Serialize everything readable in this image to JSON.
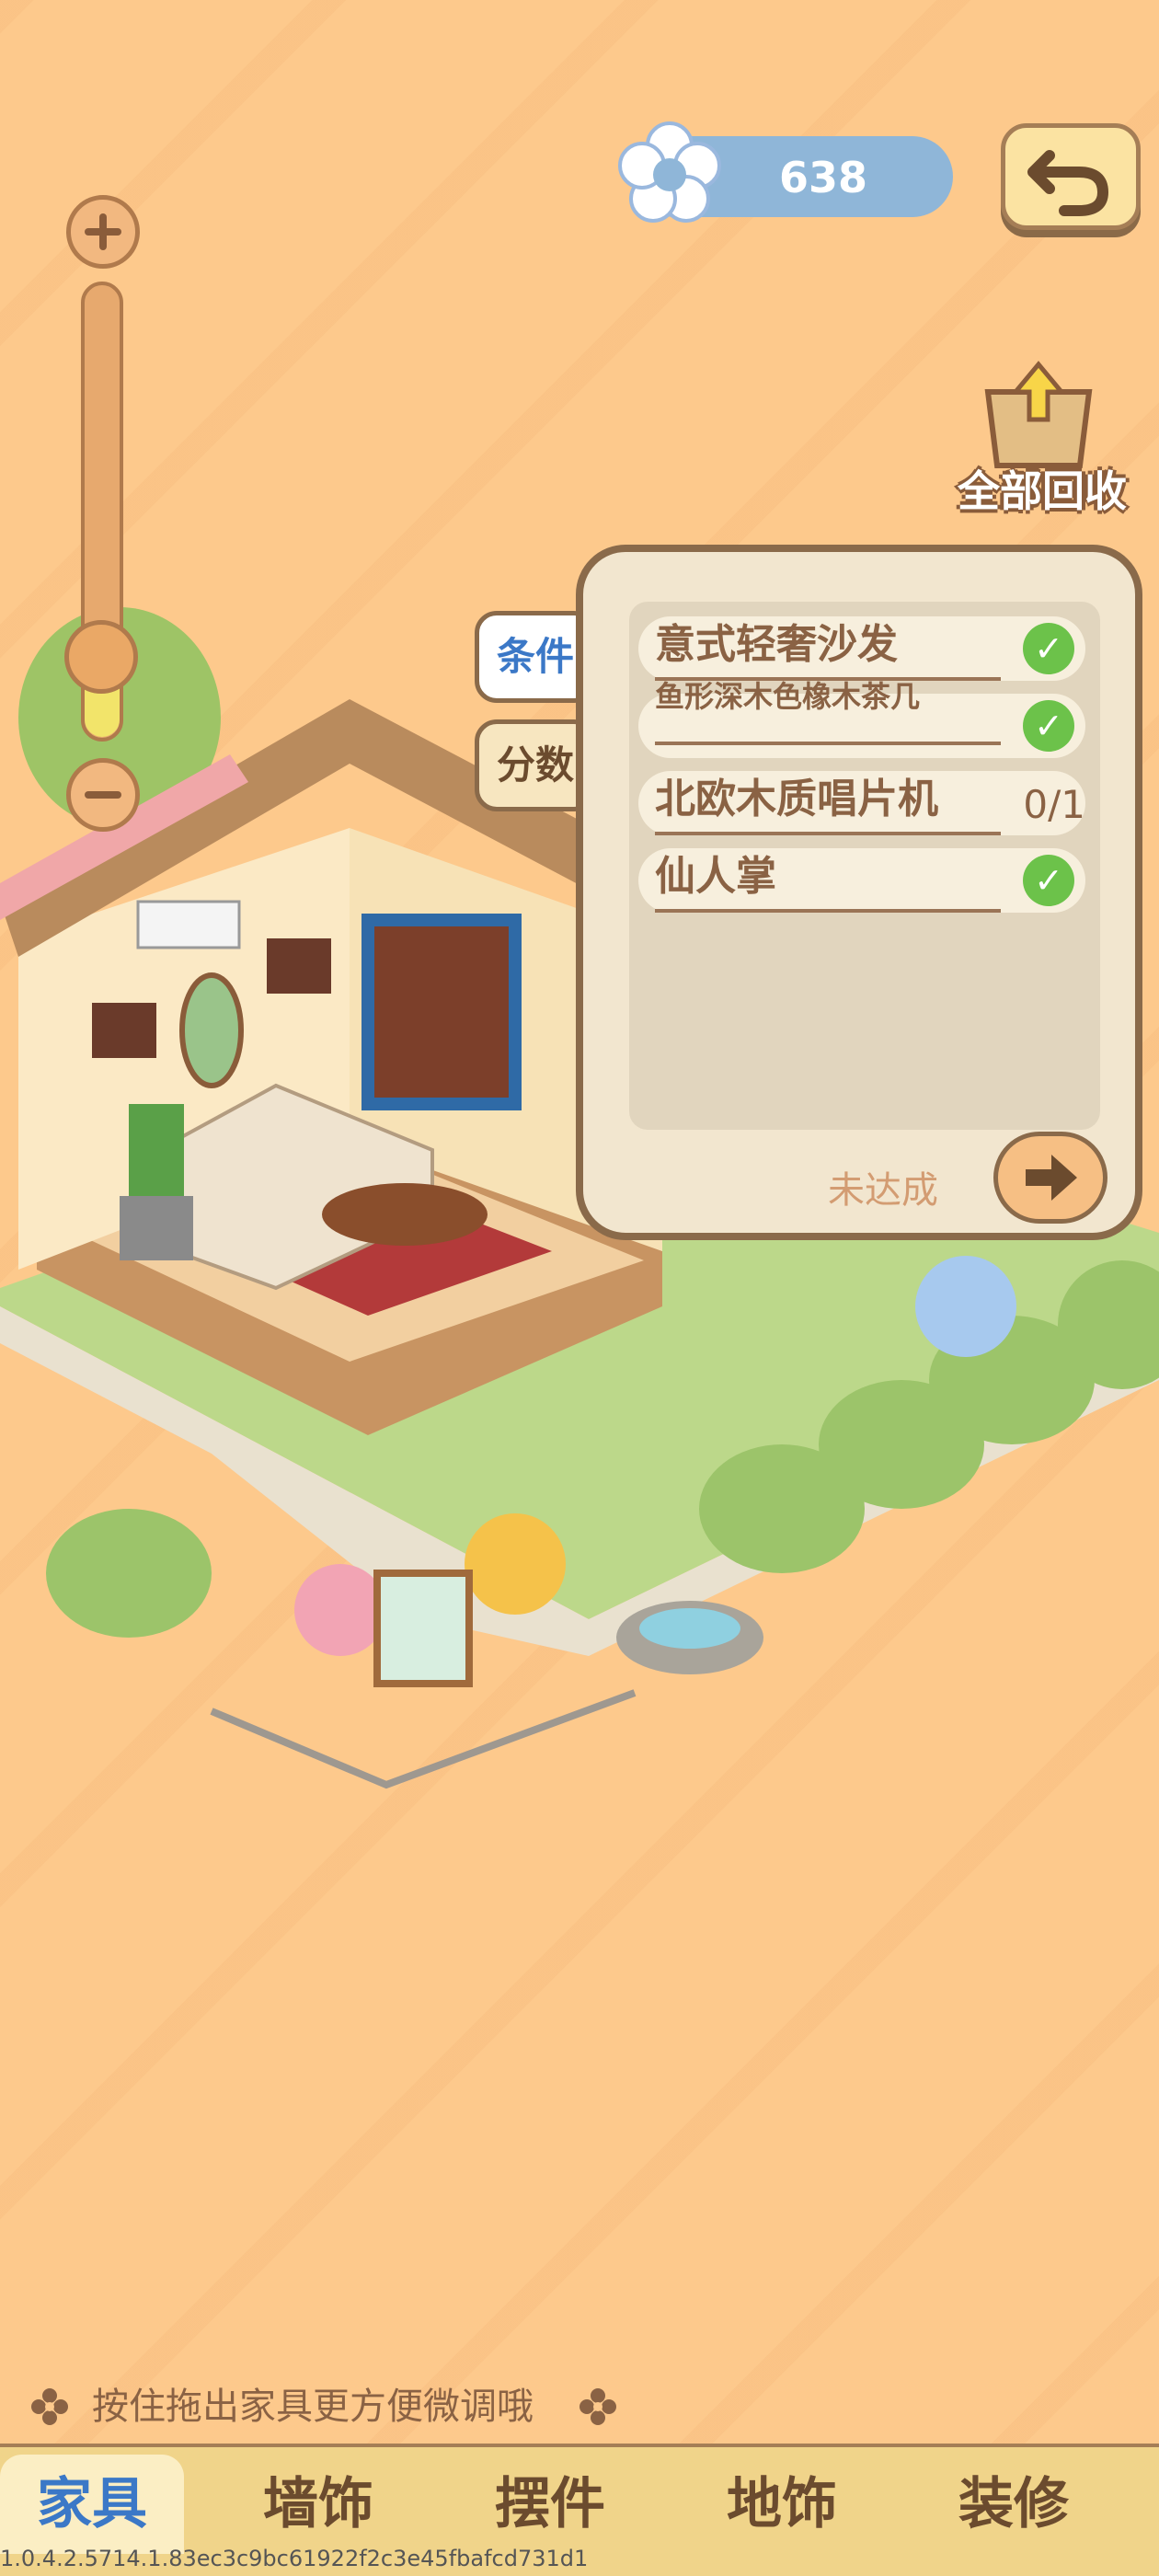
{
  "currency": {
    "icon": "flower-icon",
    "value": "638"
  },
  "back_button": {
    "icon": "undo-icon"
  },
  "zoom": {
    "plus_icon": "plus-icon",
    "minus_icon": "minus-icon",
    "level": 0.2
  },
  "recycle": {
    "icon": "box-recycle-icon",
    "label": "全部回收"
  },
  "tabs": [
    {
      "label": "条件",
      "active": true
    },
    {
      "label": "分数",
      "active": false
    }
  ],
  "conditions": [
    {
      "name": "意式轻奢沙发",
      "done": true,
      "progress": ""
    },
    {
      "name": "鱼形深木色橡木茶几",
      "done": true,
      "progress": ""
    },
    {
      "name": "北欧木质唱片机",
      "done": false,
      "progress": "0/1"
    },
    {
      "name": "仙人掌",
      "done": true,
      "progress": ""
    }
  ],
  "status": "未达成",
  "next_button": {
    "icon": "arrow-right-icon"
  },
  "hint": "按住拖出家具更方便微调哦",
  "nav": [
    {
      "label": "家具",
      "active": true
    },
    {
      "label": "墙饰",
      "active": false
    },
    {
      "label": "摆件",
      "active": false
    },
    {
      "label": "地饰",
      "active": false
    },
    {
      "label": "装修",
      "active": false
    }
  ],
  "version": "1.0.4.2.5714.1.83ec3c9bc61922f2c3e45fbafcd731d1",
  "colors": {
    "background": "#fdc98c",
    "accent_blue": "#3b78c7",
    "check_green": "#6cc24a",
    "panel": "#f2e6cf"
  }
}
